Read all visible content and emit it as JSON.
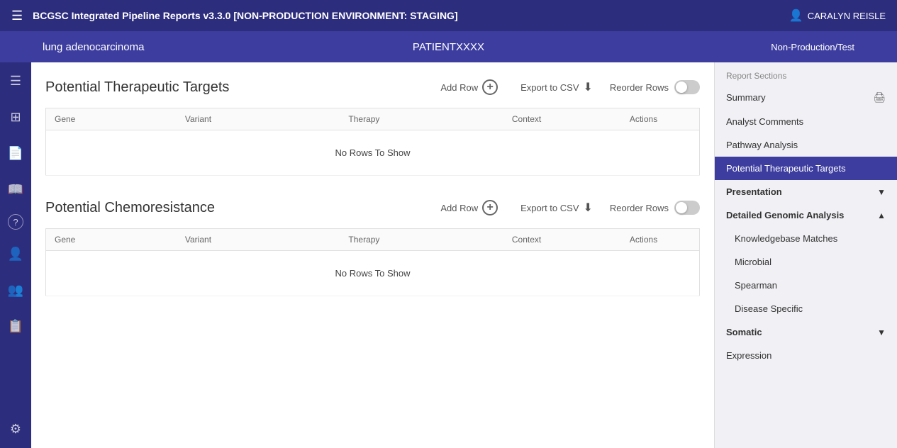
{
  "topNav": {
    "menuIcon": "☰",
    "appTitle": "BCGSC Integrated Pipeline Reports v3.3.0 [NON-PRODUCTION ENVIRONMENT: STAGING]",
    "userIcon": "👤",
    "userName": "CARALYN REISLE"
  },
  "patientBar": {
    "disease": "lung adenocarcinoma",
    "patientId": "PATIENTXXXX",
    "envLabel": "Non-Production/Test"
  },
  "leftSidebar": {
    "icons": [
      {
        "name": "menu-icon",
        "glyph": "☰"
      },
      {
        "name": "report-icon",
        "glyph": "📄"
      },
      {
        "name": "chart-icon",
        "glyph": "📊"
      },
      {
        "name": "book-icon",
        "glyph": "📖"
      },
      {
        "name": "help-icon",
        "glyph": "?"
      },
      {
        "name": "user-icon",
        "glyph": "👤"
      },
      {
        "name": "group-icon",
        "glyph": "👥"
      },
      {
        "name": "address-book-icon",
        "glyph": "📋"
      }
    ],
    "bottomIcon": {
      "name": "settings-icon",
      "glyph": "⚙"
    }
  },
  "sections": [
    {
      "id": "potential-therapeutic-targets",
      "title": "Potential Therapeutic Targets",
      "addRowLabel": "Add Row",
      "exportLabel": "Export to CSV",
      "reorderLabel": "Reorder Rows",
      "columns": [
        "Gene",
        "Variant",
        "Therapy",
        "Context",
        "Actions"
      ],
      "noRowsText": "No Rows To Show"
    },
    {
      "id": "potential-chemoresistance",
      "title": "Potential Chemoresistance",
      "addRowLabel": "Add Row",
      "exportLabel": "Export to CSV",
      "reorderLabel": "Reorder Rows",
      "columns": [
        "Gene",
        "Variant",
        "Therapy",
        "Context",
        "Actions"
      ],
      "noRowsText": "No Rows To Show"
    }
  ],
  "rightSidebar": {
    "sectionLabel": "Report Sections",
    "navItems": [
      {
        "id": "summary",
        "label": "Summary",
        "hasPrint": true,
        "active": false,
        "indent": false,
        "isGroup": false
      },
      {
        "id": "analyst-comments",
        "label": "Analyst Comments",
        "hasPrint": false,
        "active": false,
        "indent": false,
        "isGroup": false
      },
      {
        "id": "pathway-analysis",
        "label": "Pathway Analysis",
        "hasPrint": false,
        "active": false,
        "indent": false,
        "isGroup": false
      },
      {
        "id": "potential-therapeutic-targets",
        "label": "Potential Therapeutic Targets",
        "hasPrint": false,
        "active": true,
        "indent": false,
        "isGroup": false
      },
      {
        "id": "presentation",
        "label": "Presentation",
        "hasPrint": false,
        "active": false,
        "indent": false,
        "isGroup": true,
        "expanded": false,
        "chevron": "▼"
      },
      {
        "id": "detailed-genomic-analysis",
        "label": "Detailed Genomic Analysis",
        "hasPrint": false,
        "active": false,
        "indent": false,
        "isGroup": true,
        "expanded": true,
        "chevron": "▲"
      },
      {
        "id": "knowledgebase-matches",
        "label": "Knowledgebase Matches",
        "hasPrint": false,
        "active": false,
        "indent": true,
        "isGroup": false
      },
      {
        "id": "microbial",
        "label": "Microbial",
        "hasPrint": false,
        "active": false,
        "indent": true,
        "isGroup": false
      },
      {
        "id": "spearman",
        "label": "Spearman",
        "hasPrint": false,
        "active": false,
        "indent": true,
        "isGroup": false
      },
      {
        "id": "disease-specific",
        "label": "Disease Specific",
        "hasPrint": false,
        "active": false,
        "indent": true,
        "isGroup": false
      },
      {
        "id": "somatic",
        "label": "Somatic",
        "hasPrint": false,
        "active": false,
        "indent": false,
        "isGroup": true,
        "expanded": false,
        "chevron": "▼"
      },
      {
        "id": "expression",
        "label": "Expression",
        "hasPrint": false,
        "active": false,
        "indent": false,
        "isGroup": false
      }
    ]
  }
}
